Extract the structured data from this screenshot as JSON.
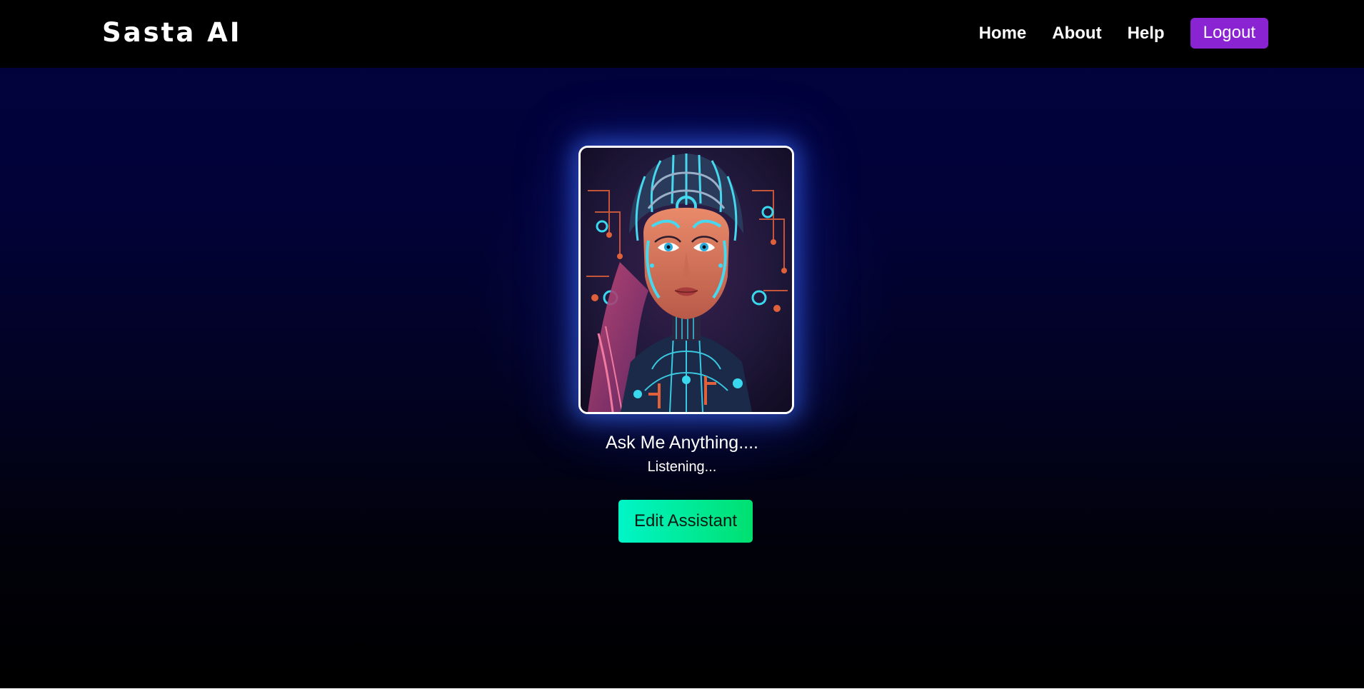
{
  "header": {
    "brand": "Sasta AI",
    "nav": {
      "home": "Home",
      "about": "About",
      "help": "Help",
      "logout": "Logout"
    }
  },
  "assistant": {
    "prompt": "Ask Me Anything....",
    "status": "Listening...",
    "edit_label": "Edit Assistant",
    "avatar": "cyberpunk-female-robot-portrait"
  },
  "colors": {
    "navbar": "#000000",
    "logout_button": "#8a24d2",
    "edit_button_start": "#00f5c8",
    "edit_button_end": "#00e070",
    "background_top": "#01013f"
  }
}
